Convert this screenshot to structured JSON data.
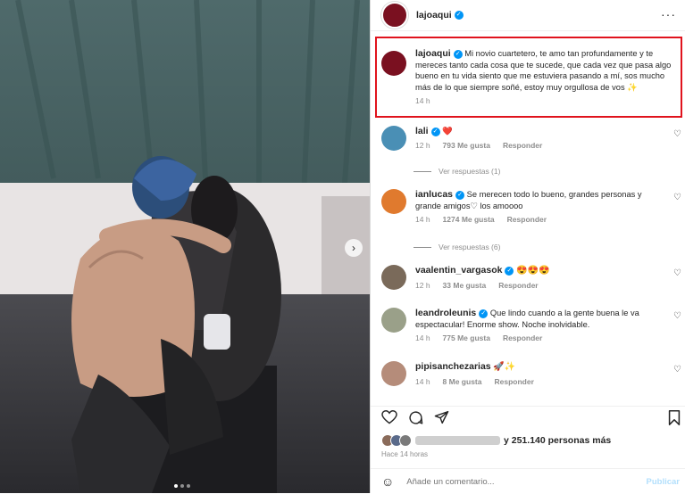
{
  "post": {
    "username": "lajoaqui",
    "more_icon": "more-dots-icon"
  },
  "caption": {
    "username": "lajoaqui",
    "text": "Mi novio cuartetero, te amo tan profundamente y te mereces tanto cada cosa que te sucede, que cada vez que pasa algo bueno en tu vida siento que me estuviera pasando a mí, sos mucho más de lo que siempre soñé, estoy muy orgullosa de vos ✨",
    "time": "14 h"
  },
  "comments": [
    {
      "username": "lali",
      "text": "❤️",
      "time": "12 h",
      "likes": "793 Me gusta",
      "reply": "Responder",
      "replies": "Ver respuestas (1)",
      "avatar_color": "#4a8fb5"
    },
    {
      "username": "ianlucas",
      "text": "Se merecen todo lo bueno, grandes personas y grande amigos♡ los amoooo",
      "time": "14 h",
      "likes": "1274 Me gusta",
      "reply": "Responder",
      "replies": "Ver respuestas (6)",
      "avatar_color": "#e07a2e"
    },
    {
      "username": "vaalentin_vargasok",
      "text": "😍😍😍",
      "time": "12 h",
      "likes": "33 Me gusta",
      "reply": "Responder",
      "replies": "",
      "avatar_color": "#7a6a5a"
    },
    {
      "username": "leandroleunis",
      "text": "Que lindo cuando a la gente buena le va espectacular! Enorme show. Noche inolvidable.",
      "time": "14 h",
      "likes": "775 Me gusta",
      "reply": "Responder",
      "replies": "",
      "avatar_color": "#9aa089"
    },
    {
      "username": "pipisanchezarias",
      "text": "🚀✨",
      "time": "14 h",
      "likes": "8 Me gusta",
      "reply": "Responder",
      "replies": "",
      "avatar_color": "#b58c7a"
    }
  ],
  "likes_summary": "y 251.140 personas más",
  "timestamp": "Hace 14 horas",
  "add_comment": {
    "placeholder": "Añade un comentario...",
    "publish": "Publicar"
  },
  "colors": {
    "verified": "#0095f6",
    "highlight_border": "#e0131d",
    "avatar": "#7a1020",
    "publish": "#b2dffc"
  }
}
